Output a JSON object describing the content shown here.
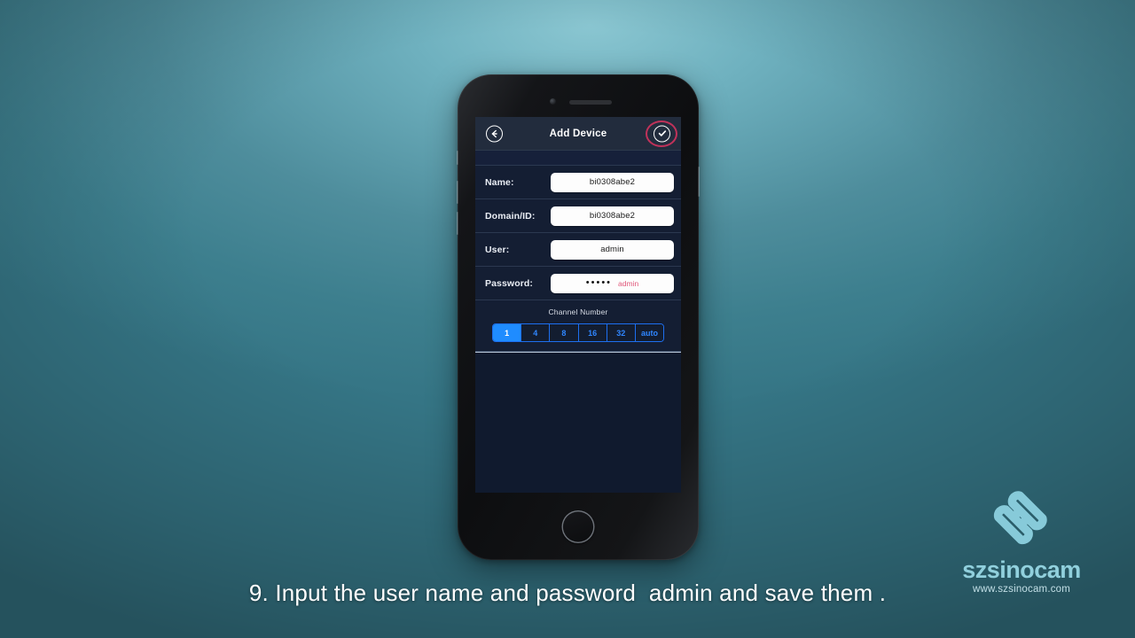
{
  "background": {
    "accent_teal": "#3d7e8c",
    "highlight_teal": "#8ac6d1"
  },
  "phone": {
    "device_label": "smartphone-mockup",
    "camera_icon": "camera-dot",
    "speaker_icon": "earpiece-speaker",
    "home_button_icon": "home-button"
  },
  "app": {
    "navbar": {
      "title": "Add Device",
      "back_icon": "back-arrow-icon",
      "confirm_icon": "check-circle-icon",
      "annotation_color": "#c0325a"
    },
    "form": {
      "fields": [
        {
          "label": "Name:",
          "value": "bi0308abe2",
          "type": "text"
        },
        {
          "label": "Domain/ID:",
          "value": "bi0308abe2",
          "type": "text"
        },
        {
          "label": "User:",
          "value": "admin",
          "type": "text"
        },
        {
          "label": "Password:",
          "value": "•••••",
          "type": "password",
          "note": "admin"
        }
      ]
    },
    "channel": {
      "title": "Channel Number",
      "options": [
        "1",
        "4",
        "8",
        "16",
        "32",
        "auto"
      ],
      "selected": "1",
      "selected_color": "#1f8cff"
    }
  },
  "caption": {
    "text": "9. Input the user name and password  admin and save them ."
  },
  "watermark": {
    "brand": "szsinocam",
    "url": "www.szsinocam.com",
    "logo_icon": "szsinocam-diamond-logo",
    "brand_color": "#9adbe8"
  }
}
